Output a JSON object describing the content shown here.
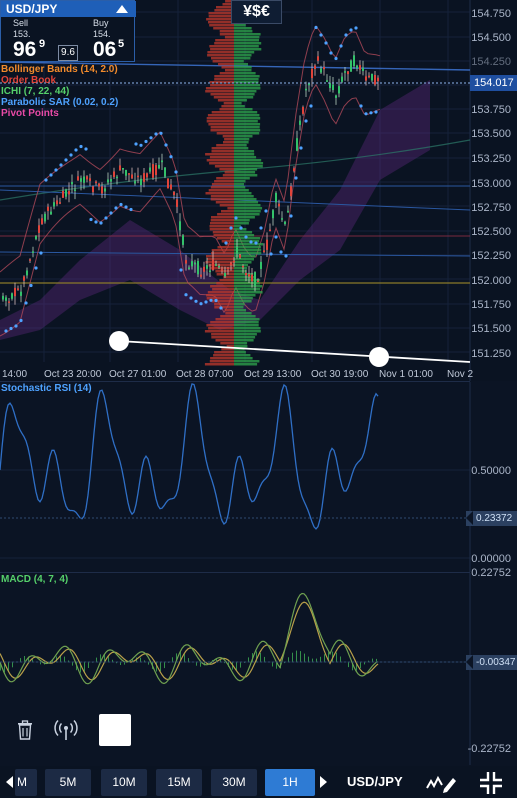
{
  "ticker": {
    "symbol": "USD/JPY",
    "sell": {
      "label": "Sell",
      "prefix": "153.",
      "big": "96",
      "small": "9"
    },
    "buy": {
      "label": "Buy",
      "prefix": "154.",
      "big": "06",
      "small": "5"
    },
    "spread": "9.6"
  },
  "currency_icon": "¥$€",
  "indicators": [
    {
      "label": "Bollinger Bands (14, 2.0)",
      "color": "#f28b2c"
    },
    {
      "label": "Order Book",
      "color": "#e0443a"
    },
    {
      "label": "ICHI (7, 22, 44)",
      "color": "#55d06a"
    },
    {
      "label": "Parabolic SAR (0.02, 0.2)",
      "color": "#4ea2ff"
    },
    {
      "label": "Pivot Points",
      "color": "#e84aa6"
    }
  ],
  "price_axis": [
    "154.750",
    "154.500",
    "154.250",
    "154.017",
    "153.750",
    "153.500",
    "153.250",
    "153.000",
    "152.750",
    "152.500",
    "152.250",
    "152.000",
    "151.750",
    "151.500",
    "151.250"
  ],
  "current_price": "154.017",
  "time_axis": [
    "14:00",
    "Oct 23 20:00",
    "Oct 27 01:00",
    "Oct 28 07:00",
    "Oct 29 13:00",
    "Oct 30 19:00",
    "Nov 1 01:00",
    "Nov 2"
  ],
  "rsi": {
    "title": "Stochastic RSI (14)",
    "axis": [
      "0.50000",
      "0.00000"
    ],
    "value": "0.23372",
    "color": "#4ea2ff"
  },
  "macd": {
    "title": "MACD (4, 7, 4)",
    "axis": [
      "0.22752",
      "-0.22752"
    ],
    "value": "-0.00347",
    "color": "#55d06a"
  },
  "bottom_bar": {
    "timeframes": [
      "5M",
      "10M",
      "15M",
      "30M",
      "1H"
    ],
    "partial_label": "M",
    "active": "1H",
    "symbol": "USD/JPY"
  },
  "colors": {
    "accent": "#2e7bd4",
    "up": "#33c26a",
    "down": "#e0443a"
  }
}
